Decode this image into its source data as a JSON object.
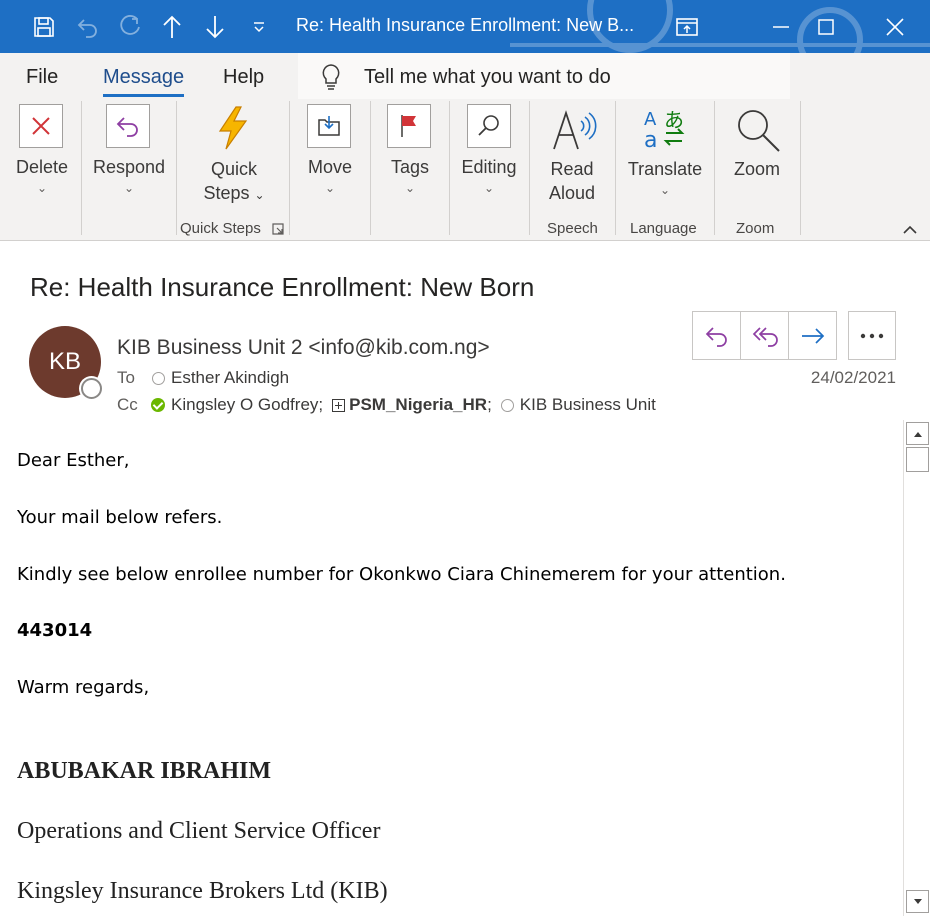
{
  "window": {
    "title": "Re: Health Insurance Enrollment: New B..."
  },
  "menu": {
    "tabs": [
      "File",
      "Message",
      "Help"
    ],
    "active_tab": "Message",
    "tell_me": "Tell me what you want to do"
  },
  "ribbon": {
    "delete": "Delete",
    "respond": "Respond",
    "quick_steps_line1": "Quick",
    "quick_steps_line2": "Steps",
    "move": "Move",
    "tags": "Tags",
    "editing": "Editing",
    "read_aloud_line1": "Read",
    "read_aloud_line2": "Aloud",
    "translate": "Translate",
    "zoom": "Zoom",
    "groups": {
      "quick_steps": "Quick Steps",
      "speech": "Speech",
      "language": "Language",
      "zoom": "Zoom"
    }
  },
  "message": {
    "subject": "Re: Health Insurance Enrollment: New Born",
    "avatar_initials": "KB",
    "sender": "KIB Business Unit 2 <info@kib.com.ng>",
    "to_label": "To",
    "to": "Esther Akindigh",
    "cc_label": "Cc",
    "cc": [
      "Kingsley O Godfrey;",
      "PSM_Nigeria_HR",
      ";",
      "KIB Business Unit"
    ],
    "date": "24/02/2021"
  },
  "body": {
    "greeting": "Dear Esther,",
    "line1": "Your mail below refers.",
    "line2": "Kindly see below enrollee number for Okonkwo Ciara Chinemerem for your attention.",
    "number": "443014",
    "closing": "Warm regards,",
    "sig_name": "ABUBAKAR IBRAHIM",
    "sig_title": "Operations and Client Service Officer",
    "sig_company": "Kingsley Insurance Brokers Ltd (KIB)"
  },
  "colors": {
    "titlebar": "#1e6fc4",
    "ribbon_bg": "#f3f2f1",
    "avatar": "#6d3a2d",
    "reply_purple": "#8e3fa3",
    "forward_blue": "#1e6fc4",
    "presence_green": "#6bb700"
  }
}
